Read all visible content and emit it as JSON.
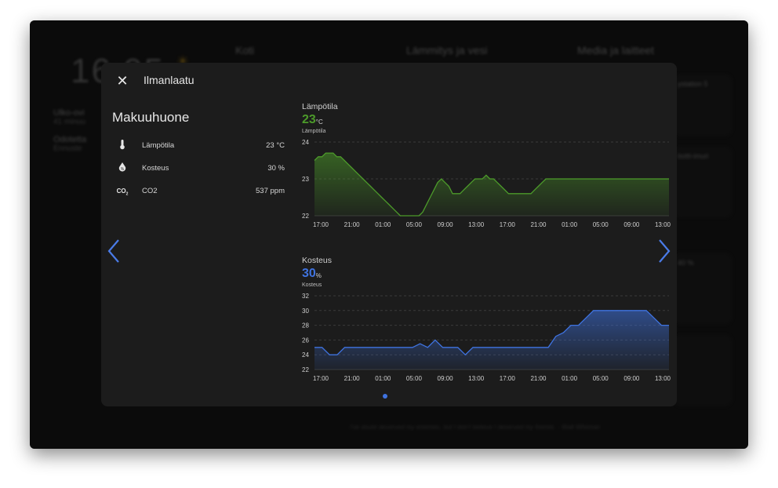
{
  "background": {
    "clock": "16:05",
    "nav": [
      "Koti",
      "Lämmitys ja vesi",
      "Media ja laitteet"
    ],
    "side_items": [
      {
        "title": "Ulko-ovi",
        "sub": "41 minuu"
      },
      {
        "title": "Odotetta",
        "sub": "Ennuste"
      }
    ],
    "cards": [
      "ystation 5",
      "botti-imuri",
      "40 %"
    ],
    "quote": "I've doubt deserved my enemies, but I don't believe I deserved my friends. - Walt Whitman"
  },
  "dialog": {
    "title": "Ilmanlaatu",
    "room": "Makuuhuone",
    "sensors": [
      {
        "icon": "thermometer-icon",
        "label": "Lämpötila",
        "value": "23 °C"
      },
      {
        "icon": "water-percent-icon",
        "label": "Kosteus",
        "value": "30 %"
      },
      {
        "icon": "co2-icon",
        "label": "CO2",
        "value": "537 ppm"
      }
    ]
  },
  "colors": {
    "temperature": "#4c9a2a",
    "humidity": "#3f73e0"
  },
  "chart_data": [
    {
      "type": "area",
      "title": "Lämpötila",
      "current": "23",
      "unit": "°C",
      "subtitle": "Lämpötila",
      "yticks": [
        22,
        23,
        24
      ],
      "ylim": [
        22,
        24
      ],
      "xticks": [
        "17:00",
        "21:00",
        "01:00",
        "05:00",
        "09:00",
        "13:00",
        "17:00",
        "21:00",
        "01:00",
        "05:00",
        "09:00",
        "13:00"
      ],
      "x": [
        0,
        0.5,
        1,
        1.5,
        2,
        2.5,
        3,
        3.5,
        4,
        4.5,
        5,
        5.5,
        6,
        6.5,
        7,
        7.5,
        8,
        8.5,
        9,
        9.5,
        10,
        10.5,
        11,
        11.5,
        12,
        12.5,
        13,
        13.5,
        14,
        14.5,
        15,
        15.5,
        16,
        16.5,
        17,
        17.5,
        18,
        18.5,
        19,
        19.5,
        20,
        20.5,
        21,
        21.5,
        22,
        22.5,
        23,
        23.5,
        24,
        24.5,
        25,
        25.5,
        26,
        26.5,
        27,
        27.5,
        28,
        28.5,
        29,
        29.5,
        30,
        30.5,
        31,
        31.5,
        32,
        32.5,
        33,
        33.5,
        34,
        34.5,
        35,
        35.5,
        36,
        36.5,
        37,
        37.5,
        38,
        38.5,
        39,
        39.5,
        40,
        40.5,
        41,
        41.5,
        42,
        42.5,
        43,
        43.5,
        44,
        44.5,
        45,
        45.5,
        46,
        46.5,
        47,
        47.5
      ],
      "values": [
        23.5,
        23.6,
        23.6,
        23.7,
        23.7,
        23.7,
        23.6,
        23.6,
        23.5,
        23.4,
        23.3,
        23.2,
        23.1,
        23.0,
        22.9,
        22.8,
        22.7,
        22.6,
        22.5,
        22.4,
        22.3,
        22.2,
        22.1,
        22.0,
        22.0,
        22.0,
        22.0,
        22.0,
        22.0,
        22.1,
        22.3,
        22.5,
        22.7,
        22.9,
        23.0,
        22.9,
        22.8,
        22.6,
        22.6,
        22.6,
        22.7,
        22.8,
        22.9,
        23.0,
        23.0,
        23.0,
        23.1,
        23.0,
        23.0,
        22.9,
        22.8,
        22.7,
        22.6,
        22.6,
        22.6,
        22.6,
        22.6,
        22.6,
        22.6,
        22.7,
        22.8,
        22.9,
        23.0,
        23.0,
        23.0,
        23.0,
        23.0,
        23.0,
        23.0,
        23.0,
        23.0,
        23.0,
        23.0,
        23.0,
        23.0,
        23.0,
        23.0,
        23.0,
        23.0,
        23.0,
        23.0,
        23.0,
        23.0,
        23.0,
        23.0,
        23.0,
        23.0,
        23.0,
        23.0,
        23.0,
        23.0,
        23.0,
        23.0,
        23.0,
        23.0,
        23.0
      ],
      "color": "#4c9a2a"
    },
    {
      "type": "area",
      "title": "Kosteus",
      "current": "30",
      "unit": "%",
      "subtitle": "Kosteus",
      "yticks": [
        22,
        24,
        26,
        28,
        30,
        32
      ],
      "ylim": [
        22,
        32
      ],
      "xticks": [
        "17:00",
        "21:00",
        "01:00",
        "05:00",
        "09:00",
        "13:00",
        "17:00",
        "21:00",
        "01:00",
        "05:00",
        "09:00",
        "13:00"
      ],
      "x": [
        0,
        1,
        2,
        3,
        4,
        5,
        6,
        7,
        8,
        9,
        10,
        11,
        12,
        13,
        14,
        15,
        16,
        17,
        18,
        19,
        20,
        21,
        22,
        23,
        24,
        25,
        26,
        27,
        28,
        29,
        30,
        31,
        32,
        33,
        34,
        35,
        36,
        37,
        38,
        39,
        40,
        41,
        42,
        43,
        44,
        45,
        46,
        47
      ],
      "values": [
        25,
        25,
        24,
        24,
        25,
        25,
        25,
        25,
        25,
        25,
        25,
        25,
        25,
        25,
        25.5,
        25,
        26,
        25,
        25,
        25,
        24,
        25,
        25,
        25,
        25,
        25,
        25,
        25,
        25,
        25,
        25,
        25,
        26.5,
        27,
        28,
        28,
        29,
        30,
        30,
        30,
        30,
        30,
        30,
        30,
        30,
        29,
        28,
        28,
        29,
        29,
        30
      ],
      "color": "#3f73e0"
    }
  ]
}
